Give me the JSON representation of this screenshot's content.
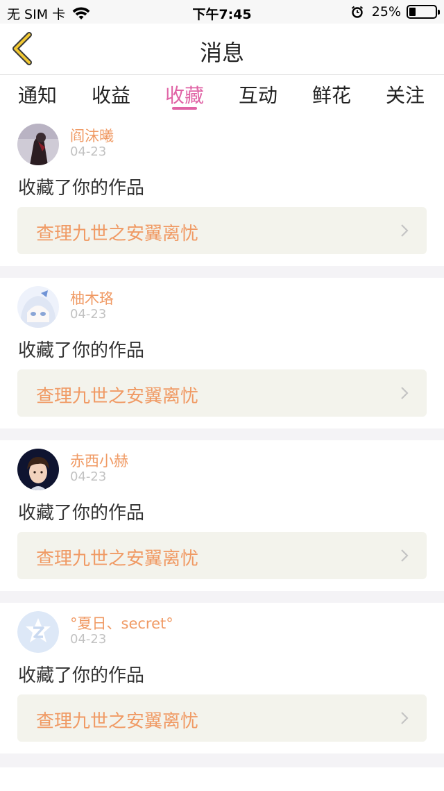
{
  "status": {
    "carrier": "无 SIM 卡",
    "time": "下午7:45",
    "battery": "25%",
    "battery_level": 0.25
  },
  "nav": {
    "title": "消息"
  },
  "tabs": [
    {
      "label": "通知"
    },
    {
      "label": "收益"
    },
    {
      "label": "收藏"
    },
    {
      "label": "互动"
    },
    {
      "label": "鲜花"
    },
    {
      "label": "关注"
    }
  ],
  "active_tab": "收藏",
  "items": [
    {
      "user": "阎沫曦",
      "date": "04-23",
      "action": "收藏了你的作品",
      "work": "查理九世之安翼离忧"
    },
    {
      "user": "柚木珞",
      "date": "04-23",
      "action": "收藏了你的作品",
      "work": "查理九世之安翼离忧"
    },
    {
      "user": "赤西小赫",
      "date": "04-23",
      "action": "收藏了你的作品",
      "work": "查理九世之安翼离忧"
    },
    {
      "user": "°夏日、secret°",
      "date": "04-23",
      "action": "收藏了你的作品",
      "work": "查理九世之安翼离忧"
    }
  ],
  "colors": {
    "accent_tab": "#e063a5",
    "username": "#f09a64",
    "work_bg": "#f3f3ec"
  }
}
